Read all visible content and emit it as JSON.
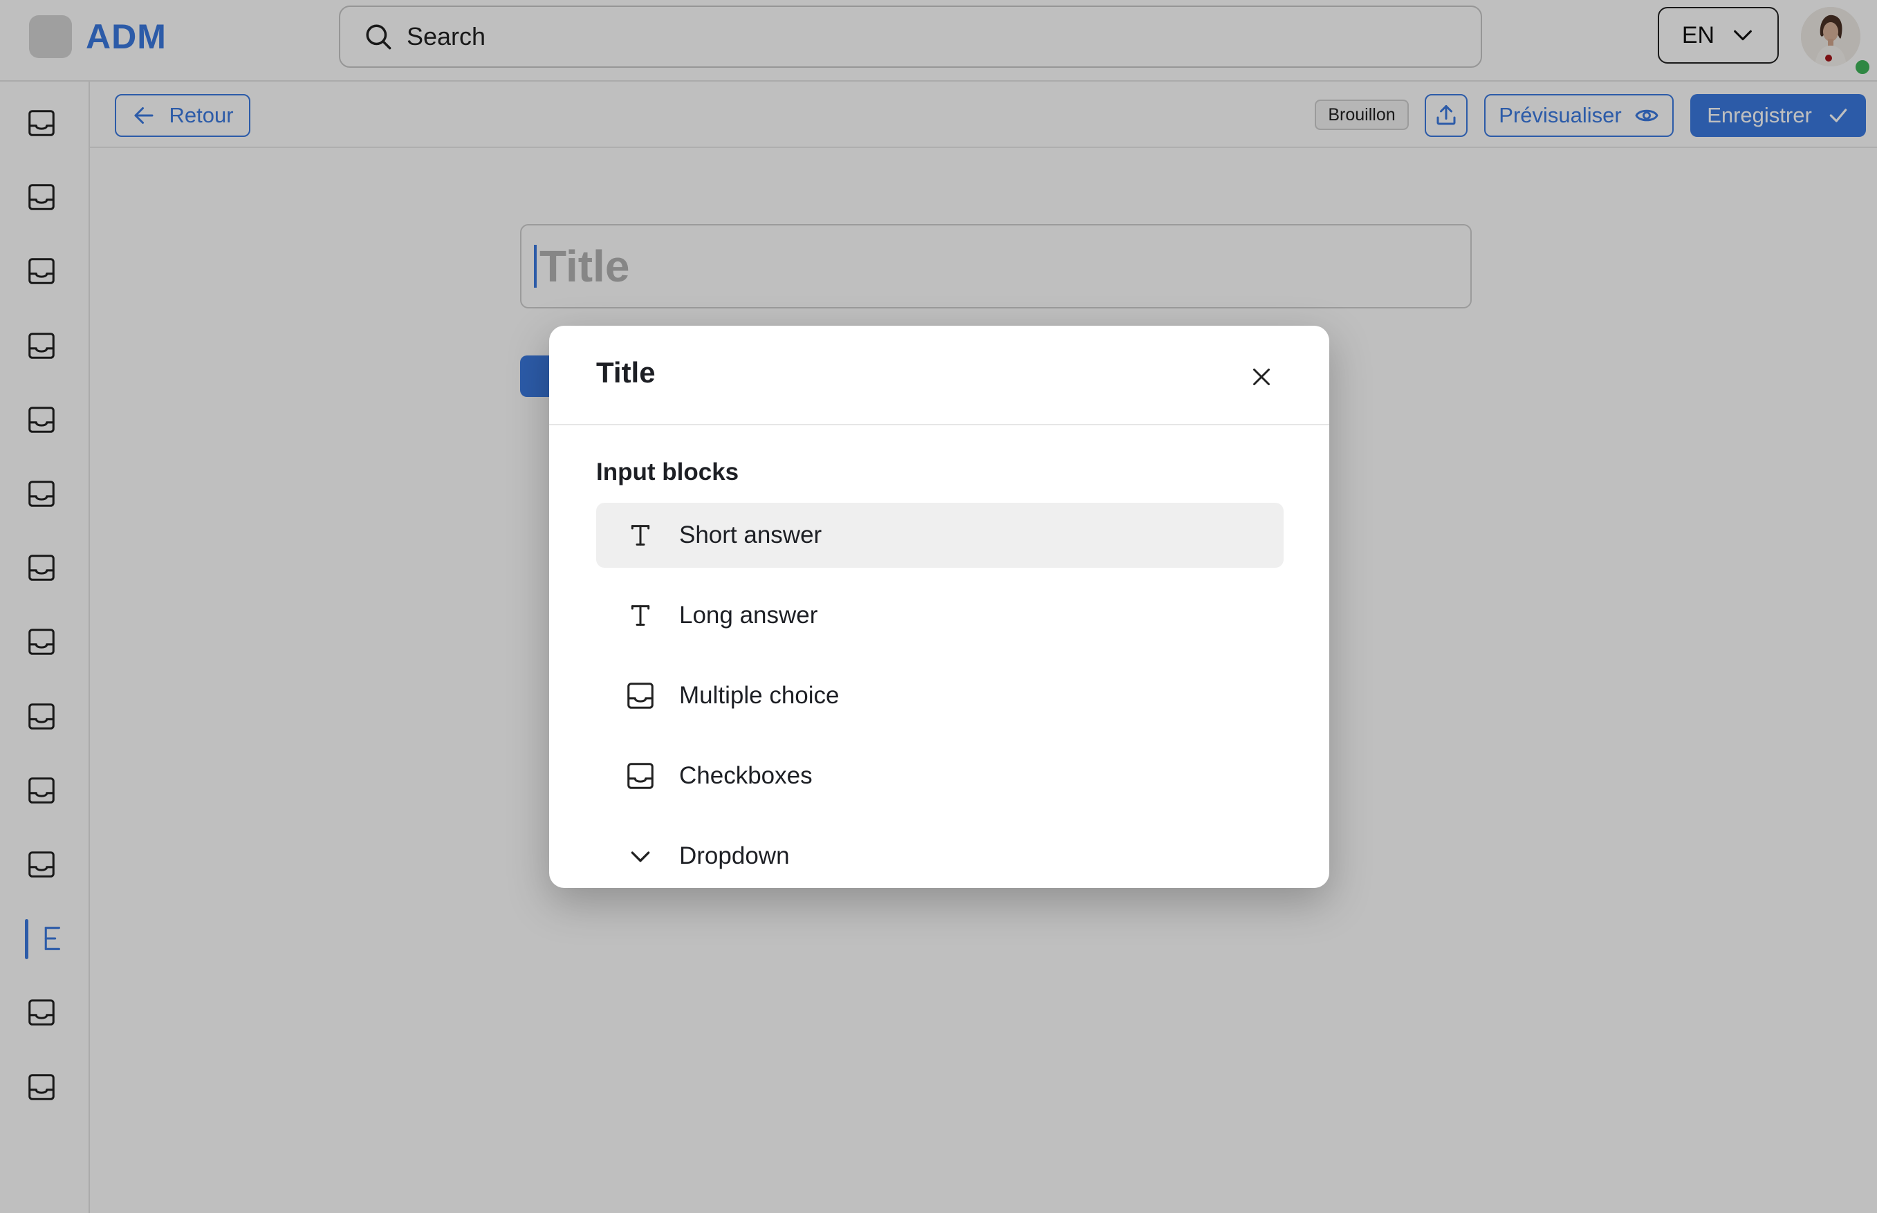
{
  "app": {
    "logo_text": "ADM"
  },
  "search": {
    "placeholder": "Search"
  },
  "language": {
    "current": "EN"
  },
  "sidebar": {
    "items": [
      {
        "icon": "inbox-icon"
      },
      {
        "icon": "inbox-icon"
      },
      {
        "icon": "inbox-icon"
      },
      {
        "icon": "inbox-icon"
      },
      {
        "icon": "inbox-icon"
      },
      {
        "icon": "inbox-icon"
      },
      {
        "icon": "inbox-icon"
      },
      {
        "icon": "inbox-icon"
      },
      {
        "icon": "inbox-icon"
      },
      {
        "icon": "inbox-icon"
      },
      {
        "icon": "inbox-icon"
      },
      {
        "icon": "form-builder-icon",
        "active": true
      },
      {
        "icon": "inbox-icon"
      },
      {
        "icon": "inbox-icon"
      }
    ]
  },
  "toolbar": {
    "back_label": "Retour",
    "status_badge": "Brouillon",
    "preview_label": "Prévisualiser",
    "save_label": "Enregistrer"
  },
  "editor": {
    "title_placeholder": "Title"
  },
  "modal": {
    "title": "Title",
    "section_label": "Input blocks",
    "blocks": [
      {
        "label": "Short answer",
        "icon": "text-icon",
        "hovered": true
      },
      {
        "label": "Long answer",
        "icon": "text-icon"
      },
      {
        "label": "Multiple choice",
        "icon": "inbox-icon"
      },
      {
        "label": "Checkboxes",
        "icon": "inbox-icon"
      },
      {
        "label": "Dropdown",
        "icon": "chevron-down-icon"
      }
    ]
  },
  "colors": {
    "accent": "#3b7ae0",
    "online": "#3fb55a",
    "overlay": "rgba(0,0,0,0.25)"
  }
}
